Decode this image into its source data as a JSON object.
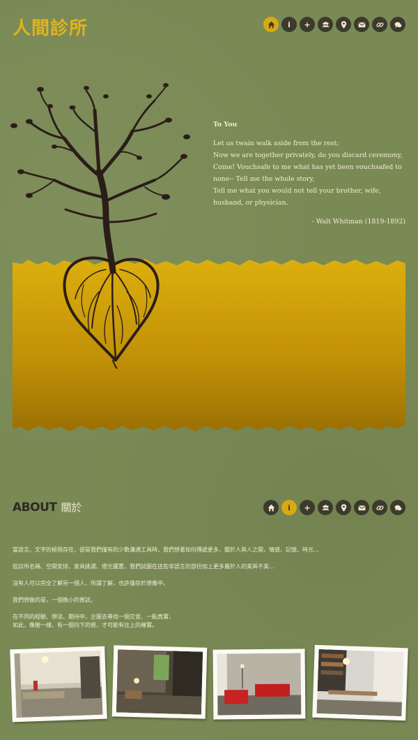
{
  "header": {
    "logo": "人間診所",
    "nav": [
      {
        "name": "home-icon",
        "glyph": ""
      },
      {
        "name": "info-icon",
        "glyph": "i"
      },
      {
        "name": "plus-icon",
        "glyph": "+"
      },
      {
        "name": "people-icon",
        "glyph": ""
      },
      {
        "name": "map-pin-icon",
        "glyph": ""
      },
      {
        "name": "mail-icon",
        "glyph": ""
      },
      {
        "name": "link-icon",
        "glyph": ""
      },
      {
        "name": "chat-icon",
        "glyph": ""
      }
    ]
  },
  "poem": {
    "title": "To You",
    "lines": [
      "Let us twain walk aside from the rest;",
      "Now we are together privately, do you discard ceremony,",
      "Come! Vouchsafe to me what has yet been vouchsafed to",
      "none-- Tell me the whole story,",
      "Tell me what you would not tell your brother, wife,",
      "husband, or physician."
    ],
    "author": "- Walt Whitman (1819-1892)"
  },
  "about": {
    "title_en": "ABOUT",
    "title_zh": "關於",
    "paragraphs": [
      [
        "當語言、文字的極限存在，卻是我們僅有的少數溝通工具時，我們想著如何傳遞更多，關於人與人之間，情感、記憶、時光…"
      ],
      [
        "從診所名稱、空間安排、家具挑選、燈光擺置，我們試圖在這些非語言的部份加上更多屬於人的美與不美…"
      ],
      [
        "沒有人可以完全了解另一個人，所謂了解，也許僅存於想像中。"
      ],
      [
        "我們想做的是，一個微小的嘗試，"
      ],
      [
        "在不同的經驗、想法、期待中，企圖去尋找一個交會、一點真實，",
        "如此，像樹一樣，有一個向下的根，才可能有往上的確實。"
      ]
    ]
  },
  "colors": {
    "background": "#7a8a55",
    "accent": "#e2b21f",
    "band_top": "#dcaf0e",
    "band_bottom": "#9a7003",
    "icon_dark": "#3c3a2c",
    "tree": "#2b1d18"
  }
}
